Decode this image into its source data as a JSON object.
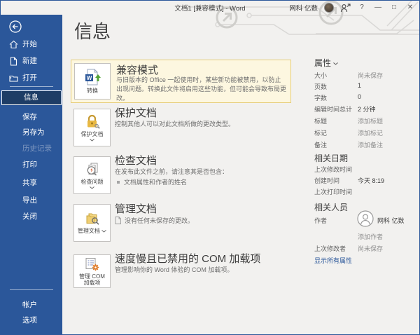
{
  "titlebar": {
    "title": "文档1 [兼容模式] - Word",
    "account_name": "网科 亿数",
    "help_label": "?",
    "minimize_label": "—",
    "maximize_label": "□",
    "close_label": "✕"
  },
  "sidebar": {
    "items": [
      {
        "label": "开始"
      },
      {
        "label": "新建"
      },
      {
        "label": "打开"
      },
      {
        "label": "信息",
        "selected": true
      },
      {
        "label": "保存"
      },
      {
        "label": "另存为"
      },
      {
        "label": "历史记录",
        "disabled": true
      },
      {
        "label": "打印"
      },
      {
        "label": "共享"
      },
      {
        "label": "导出"
      },
      {
        "label": "关闭"
      },
      {
        "label": "帐户"
      },
      {
        "label": "选项"
      }
    ]
  },
  "main": {
    "heading": "信息",
    "compat": {
      "button_label": "转换",
      "title": "兼容模式",
      "description": "与旧版本的 Office 一起使用时，某些新功能被禁用，以防止出现问题。转换此文件将启用这些功能，但可能会导致布局更改。"
    },
    "protect": {
      "button_label": "保护文档",
      "title": "保护文档",
      "description": "控制其他人可以对此文档所做的更改类型。"
    },
    "inspect": {
      "button_label": "检查问题",
      "title": "检查文档",
      "description": "在发布此文件之前，请注意其是否包含：",
      "bullet": "文档属性和作者的姓名"
    },
    "manage": {
      "button_label": "管理文档",
      "title": "管理文档",
      "item": "没有任何未保存的更改。"
    },
    "com": {
      "button_label": "管理 COM 加载项",
      "title": "速度慢且已禁用的 COM 加载项",
      "description": "管理影响你的 Word 体验的 COM 加载项。"
    }
  },
  "properties": {
    "header": "属性",
    "rows": [
      {
        "label": "大小",
        "value": "尚未保存",
        "muted": true
      },
      {
        "label": "页数",
        "value": "1"
      },
      {
        "label": "字数",
        "value": "0"
      },
      {
        "label": "编辑时间总计",
        "value": "2 分钟"
      },
      {
        "label": "标题",
        "value": "添加标题",
        "muted": true
      },
      {
        "label": "标记",
        "value": "添加标记",
        "muted": true
      },
      {
        "label": "备注",
        "value": "添加备注",
        "muted": true
      }
    ]
  },
  "dates": {
    "header": "相关日期",
    "rows": [
      {
        "label": "上次修改时间",
        "value": ""
      },
      {
        "label": "创建时间",
        "value": "今天 8:19"
      },
      {
        "label": "上次打印时间",
        "value": ""
      }
    ]
  },
  "people": {
    "header": "相关人员",
    "author_label": "作者",
    "author_name": "网科 亿数",
    "add_author": "添加作者",
    "last_modified_by_label": "上次修改者",
    "last_modified_by_value": "尚未保存"
  },
  "footer": {
    "show_all_link": "显示所有属性"
  },
  "colors": {
    "sidebar_blue": "#2b579a",
    "sidebar_selected": "#1e3d66",
    "background_gray": "#f2f1ef",
    "compat_bg": "#fdf7e0",
    "compat_border": "#e6cd79",
    "link_blue": "#2b579a",
    "lock_gold": "#e8b842",
    "gear_orange": "#e07a28",
    "convert_green": "#53a336",
    "word_blue": "#2b579a"
  }
}
